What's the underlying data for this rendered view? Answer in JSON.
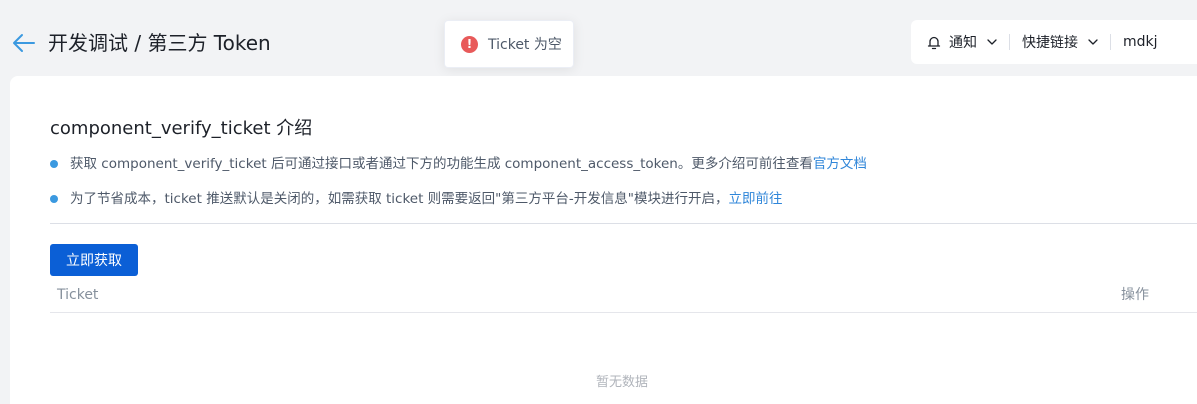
{
  "header": {
    "title": "开发调试 / 第三方 Token"
  },
  "toast": {
    "type": "error",
    "icon_glyph": "!",
    "message": "Ticket 为空"
  },
  "toolbar": {
    "notify_label": "通知",
    "quicklinks_label": "快捷链接",
    "user_label": "mdkj"
  },
  "intro": {
    "title": "component_verify_ticket 介绍",
    "line1_text": "获取 component_verify_ticket 后可通过接口或者通过下方的功能生成 component_access_token。更多介绍可前往查看",
    "line1_link": "官方文档",
    "line2_text": "为了节省成本，ticket 推送默认是关闭的，如需获取 ticket 则需要返回\"第三方平台-开发信息\"模块进行开启，",
    "line2_link": "立即前往"
  },
  "actions": {
    "fetch_label": "立即获取"
  },
  "table": {
    "columns": [
      "Ticket",
      "操作"
    ],
    "rows": [],
    "empty_text": "暂无数据"
  },
  "colors": {
    "primary": "#0b5fd6",
    "link": "#2f86d9",
    "bullet": "#3b99e0",
    "error": "#e85a5a",
    "page_bg": "#f2f3f5"
  }
}
